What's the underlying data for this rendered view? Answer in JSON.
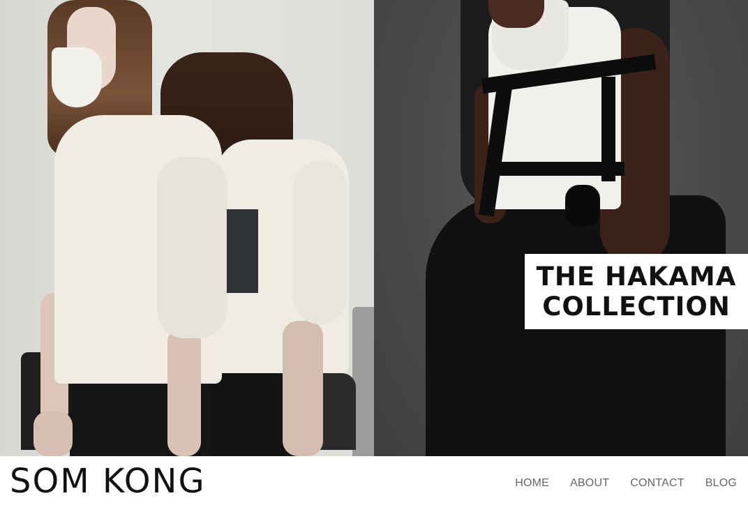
{
  "site": {
    "logo": "SOM KONG"
  },
  "nav": {
    "items": [
      {
        "label": "HOME"
      },
      {
        "label": "ABOUT"
      },
      {
        "label": "CONTACT"
      },
      {
        "label": "BLOG"
      }
    ]
  },
  "hero": {
    "collection_title": "THE HAKAMA COLLECTION"
  },
  "colors": {
    "nav_text": "#666666",
    "logo": "#111111",
    "badge_bg": "#ffffff",
    "right_panel_bg": "#4a4a4c"
  }
}
